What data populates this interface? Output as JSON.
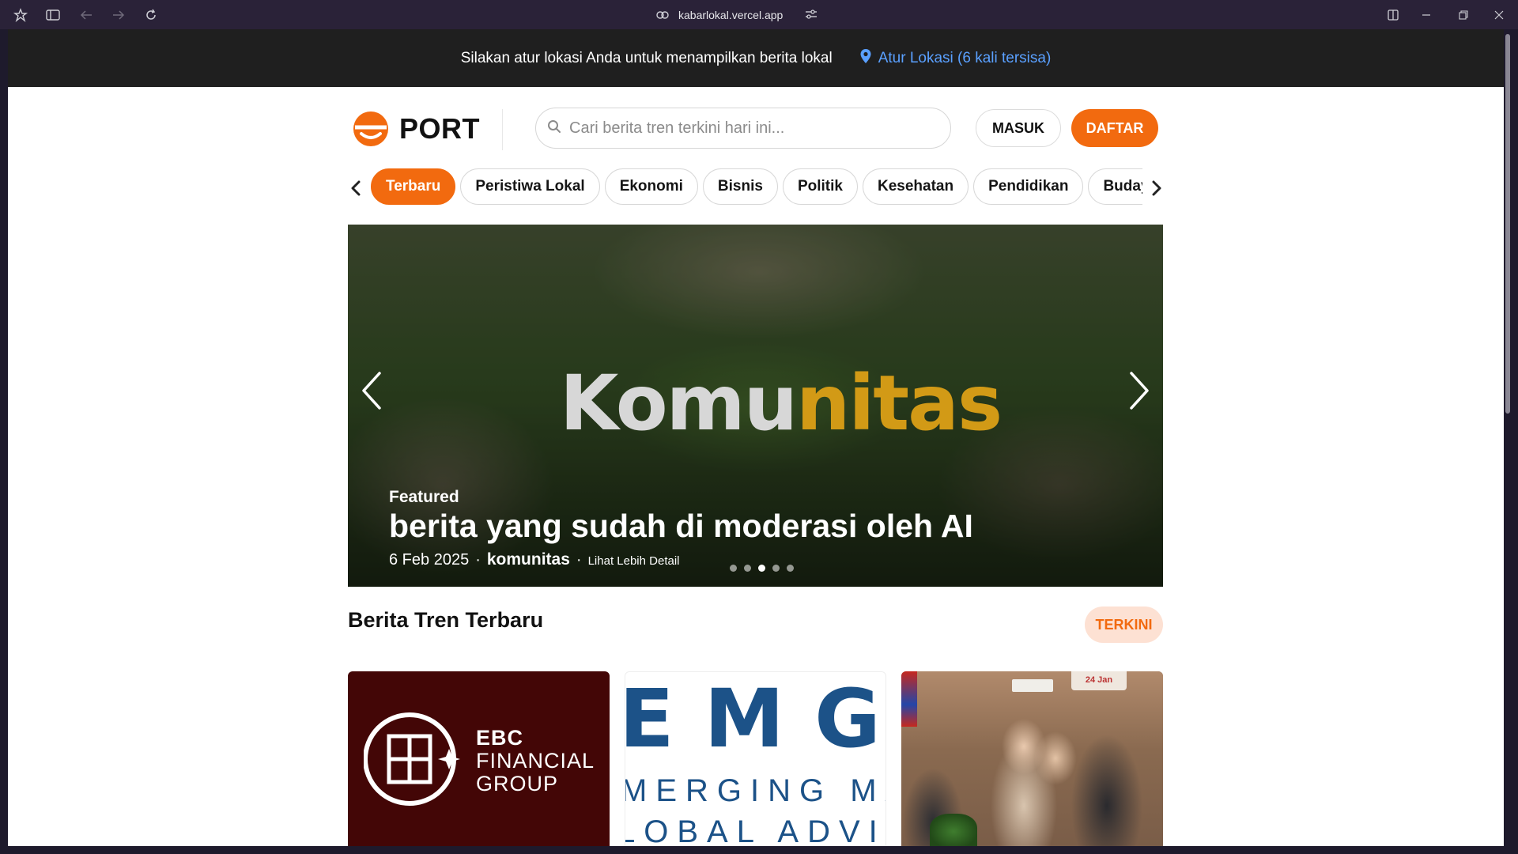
{
  "browser": {
    "url": "kabarlokal.vercel.app"
  },
  "banner": {
    "message": "Silakan atur lokasi Anda untuk menampilkan berita lokal",
    "location_link": "Atur Lokasi (6 kali tersisa)"
  },
  "header": {
    "logo_text": "PORT",
    "search_placeholder": "Cari berita tren terkini hari ini...",
    "login_label": "MASUK",
    "register_label": "DAFTAR"
  },
  "categories": [
    "Terbaru",
    "Peristiwa Lokal",
    "Ekonomi",
    "Bisnis",
    "Politik",
    "Kesehatan",
    "Pendidikan",
    "Budaya"
  ],
  "active_category": "Terbaru",
  "hero": {
    "image_text_part1": "Komu",
    "image_text_part2": "nitas",
    "featured_label": "Featured",
    "title": "berita yang sudah di moderasi oleh AI",
    "date": "6 Feb 2025",
    "source": "komunitas",
    "more_link": "Lihat Lebih Detail",
    "slide_count": 5,
    "active_slide": 3
  },
  "section": {
    "title": "Berita Tren Terbaru",
    "badge": "TERKINI"
  },
  "cards": [
    {
      "logo_line1": "EBC",
      "logo_line2": "FINANCIAL",
      "logo_line3": "GROUP"
    },
    {
      "big_text": "EMG",
      "line2": "MERGING MA",
      "line3": "LOBAL ADVIS"
    },
    {
      "sign_text": "24 Jan"
    }
  ],
  "colors": {
    "accent": "#f26a0f",
    "banner_bg": "#1f1f1f",
    "link_blue": "#5aa0ff",
    "ebc_bg": "#430606",
    "emg_blue": "#1c5288"
  }
}
